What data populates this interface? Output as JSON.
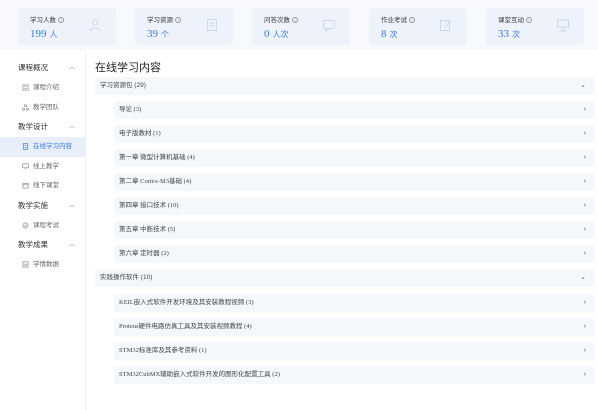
{
  "stats": [
    {
      "label": "学习人数",
      "value": "199",
      "unit": "人",
      "accent": "#3a7bd5",
      "icon": "user-icon"
    },
    {
      "label": "学习资源",
      "value": "39",
      "unit": "个",
      "accent": "#3a7bd5",
      "icon": "document-icon"
    },
    {
      "label": "问答次数",
      "value": "0",
      "unit": "人次",
      "accent": "#3a7bd5",
      "icon": "chat-icon"
    },
    {
      "label": "作业考试",
      "value": "8",
      "unit": "次",
      "accent": "#3a7bd5",
      "icon": "edit-icon"
    },
    {
      "label": "课堂互动",
      "value": "33",
      "unit": "次",
      "accent": "#3a7bd5",
      "icon": "presentation-icon"
    }
  ],
  "sidebar": {
    "groups": [
      {
        "label": "课程概况",
        "items": [
          {
            "label": "课程介绍",
            "icon": "book-icon",
            "active": false
          },
          {
            "label": "教学团队",
            "icon": "team-icon",
            "active": false
          }
        ]
      },
      {
        "label": "教学设计",
        "items": [
          {
            "label": "在线学习内容",
            "icon": "file-icon",
            "active": true
          },
          {
            "label": "线上教学",
            "icon": "screen-icon",
            "active": false
          },
          {
            "label": "线下课堂",
            "icon": "calendar-icon",
            "active": false
          }
        ]
      },
      {
        "label": "教学实施",
        "items": [
          {
            "label": "课程考试",
            "icon": "exam-icon",
            "active": false
          }
        ]
      },
      {
        "label": "教学成果",
        "items": [
          {
            "label": "学情数据",
            "icon": "data-icon",
            "active": false
          }
        ]
      }
    ]
  },
  "main": {
    "title": "在线学习内容",
    "sections": [
      {
        "label": "学习资源包 (29)",
        "expanded": true,
        "children": [
          "导论 (3)",
          "电子版教材 (1)",
          "第一章 微型计算机基础 (4)",
          "第二章 Cortex-M3基础 (4)",
          "第四章 接口技术 (10)",
          "第五章 中断技术 (5)",
          "第六章 定时器 (2)"
        ]
      },
      {
        "label": "实践操作软件 (10)",
        "expanded": true,
        "children": [
          "KEIL嵌入式软件开发环境及其安装教程视频 (3)",
          "Proteus硬件电路仿真工具及其安装视频教程 (4)",
          "STM32标准库及其参考资料 (1)",
          "STM32CubMX辅助嵌入式软件开发的图形化配置工具 (2)"
        ]
      }
    ]
  }
}
